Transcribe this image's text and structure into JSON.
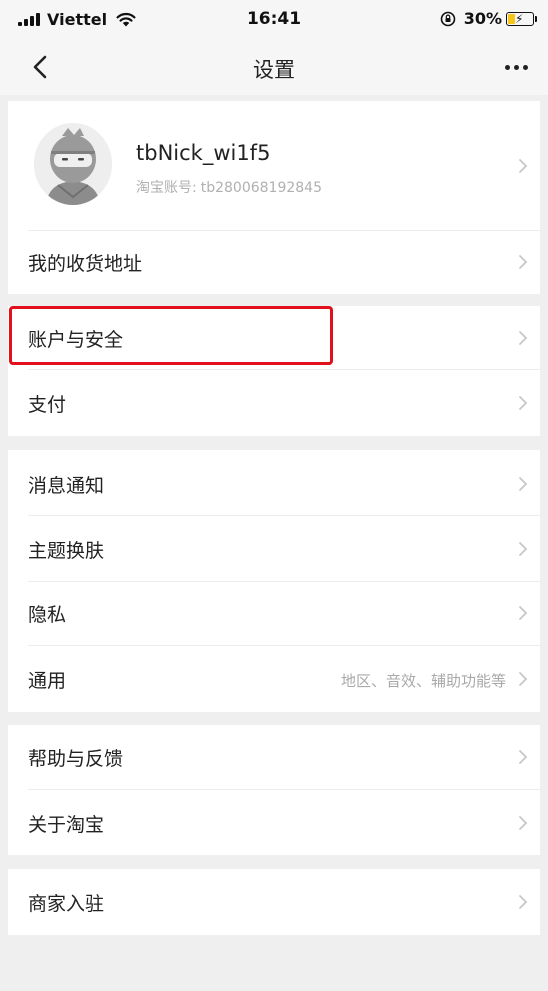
{
  "status_bar": {
    "carrier": "Viettel",
    "time": "16:41",
    "battery_percent": "30%",
    "battery_level": 0.3,
    "battery_color": "#f5c518"
  },
  "nav": {
    "title": "设置",
    "back_icon": "chevron-left-icon",
    "more_icon": "more-horizontal-icon"
  },
  "profile": {
    "username": "tbNick_wi1f5",
    "account_label": "淘宝账号:",
    "account_id": "tb280068192845",
    "avatar_icon": "ninja-avatar-icon"
  },
  "menu": {
    "address": "我的收货地址",
    "account_security": "账户与安全",
    "payment": "支付",
    "notifications": "消息通知",
    "theme": "主题换肤",
    "privacy": "隐私",
    "general": "通用",
    "general_detail": "地区、音效、辅助功能等",
    "help_feedback": "帮助与反馈",
    "about": "关于淘宝",
    "merchant": "商家入驻"
  },
  "highlight_color": "#e0101c"
}
